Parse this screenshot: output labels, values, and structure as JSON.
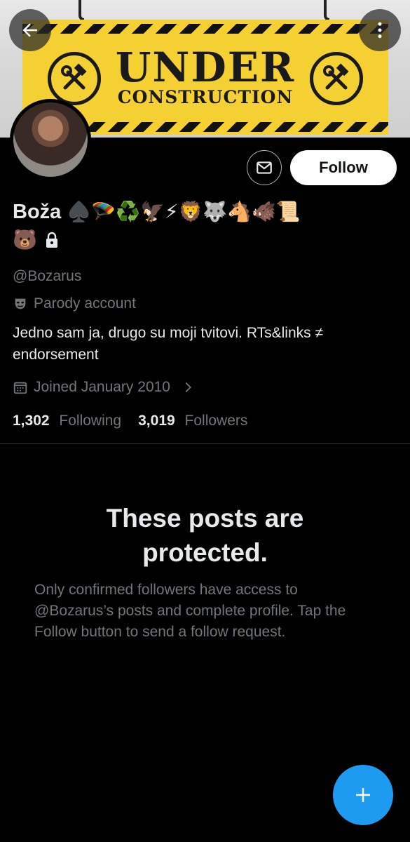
{
  "banner": {
    "line1": "UNDER",
    "line2": "CONSTRUCTION"
  },
  "profile": {
    "name": "Boža",
    "name_emojis": "♠️🪂♻️🦅⚡🦁🐺🐴🐗📜",
    "name_emojis_line2": "🐻",
    "handle": "@Bozarus",
    "parody_label": "Parody account",
    "bio": "Jedno sam ja, drugo su moji tvitovi. RTs&links ≠ endorsement",
    "joined": "Joined January 2010",
    "following_count": "1,302",
    "following_label": "Following",
    "followers_count": "3,019",
    "followers_label": "Followers"
  },
  "actions": {
    "follow_label": "Follow"
  },
  "protected": {
    "title": "These posts are protected.",
    "description": "Only confirmed followers have access to @Bozarus’s posts and complete profile. Tap the Follow button to send a follow request."
  },
  "icons": {
    "back": "arrow-left-icon",
    "more": "more-vertical-icon",
    "mail": "mail-icon",
    "lock": "lock-icon",
    "parody": "mask-icon",
    "calendar": "calendar-icon",
    "chevron": "chevron-right-icon",
    "compose": "plus-icon"
  },
  "colors": {
    "accent": "#1d9bf0",
    "background": "#000000",
    "secondary_text": "#71767b",
    "banner_yellow": "#f4d033"
  }
}
